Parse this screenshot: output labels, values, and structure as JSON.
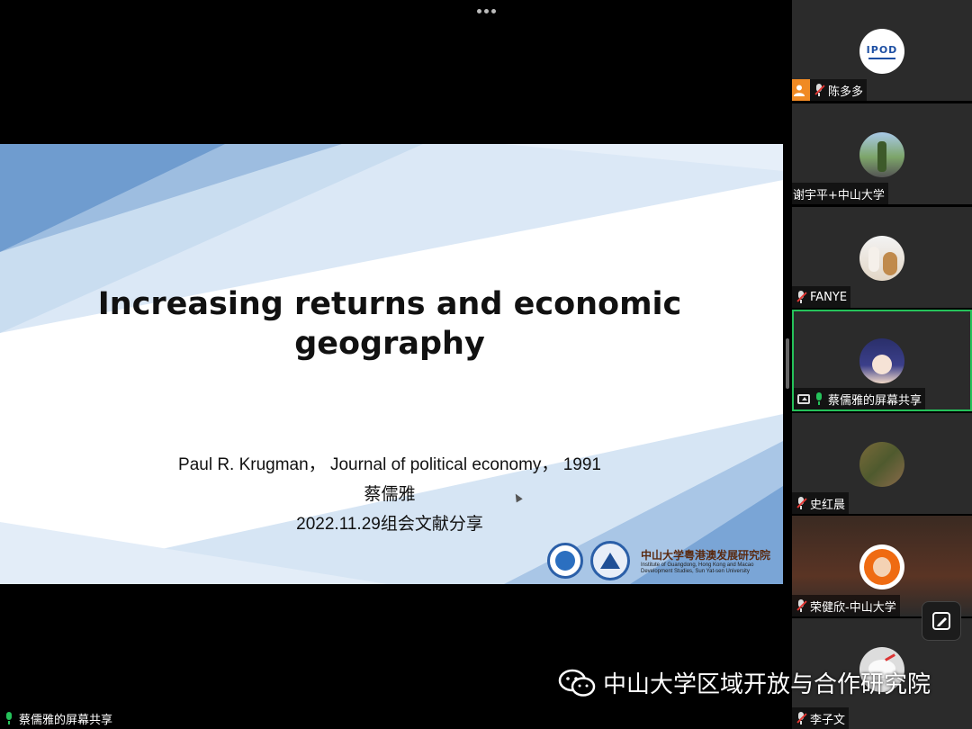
{
  "slide": {
    "title_line1": "Increasing returns and economic",
    "title_line2": "geography",
    "citation": "Paul R. Krugman， Journal of political economy，  1991",
    "presenter": "蔡儒雅",
    "date_event": "2022.11.29组会文献分享",
    "institute_cn": "中山大学粤港澳发展研究院",
    "institute_en_1": "Institute of Guangdong, Hong Kong and Macao",
    "institute_en_2": "Development Studies, Sun Yat-sen University",
    "accent_color": "#2b5fa8"
  },
  "participants": [
    {
      "name": "陈多多",
      "mic": "muted",
      "avatar": "ipod-logo",
      "host": true,
      "avatar_text": "IPOD"
    },
    {
      "name": "谢宇平+中山大学",
      "mic": "none",
      "avatar": "tree-photo"
    },
    {
      "name": "FANYE",
      "mic": "muted",
      "avatar": "dog-photo"
    },
    {
      "name": "蔡儒雅的屏幕共享",
      "mic": "on",
      "avatar": "anime-girl",
      "sharing": true
    },
    {
      "name": "史红晨",
      "mic": "muted",
      "avatar": "painting"
    },
    {
      "name": "荣健欣-中山大学",
      "mic": "muted",
      "avatar": "cartoon-orange"
    },
    {
      "name": "李子文",
      "mic": "muted",
      "avatar": "white-bird"
    }
  ],
  "watermark": {
    "text": "中山大学区域开放与合作研究院",
    "icon": "wechat-icon"
  },
  "share_label": "蔡儒雅的屏幕共享",
  "colors": {
    "active_border": "#25c25a",
    "mute_red": "#e53935",
    "host_orange": "#f08a24"
  }
}
